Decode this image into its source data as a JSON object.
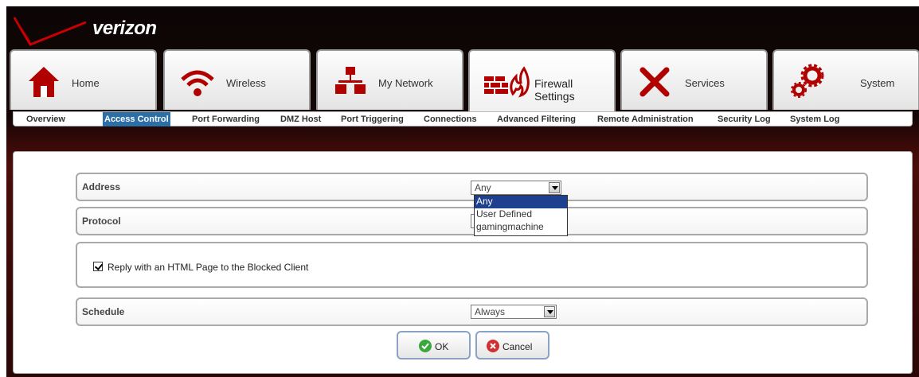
{
  "brand": {
    "logo_text": "verizon",
    "accent": "#cc0000"
  },
  "main_tabs": [
    {
      "label": "Home",
      "icon": "home-icon"
    },
    {
      "label": "Wireless",
      "icon": "wireless-icon"
    },
    {
      "label": "My Network",
      "icon": "network-icon"
    },
    {
      "label": "Firewall Settings",
      "icon": "firewall-icon",
      "active": true
    },
    {
      "label": "Services",
      "icon": "tools-icon"
    },
    {
      "label": "System",
      "icon": "gears-icon"
    }
  ],
  "sub_nav": [
    {
      "label": "Overview"
    },
    {
      "label": "Access Control",
      "active": true
    },
    {
      "label": "Port Forwarding"
    },
    {
      "label": "DMZ Host"
    },
    {
      "label": "Port Triggering"
    },
    {
      "label": "Connections"
    },
    {
      "label": "Advanced Filtering"
    },
    {
      "label": "Remote Administration"
    },
    {
      "label": "Security Log"
    },
    {
      "label": "System Log"
    }
  ],
  "form": {
    "address": {
      "label": "Address",
      "value": "Any"
    },
    "protocol": {
      "label": "Protocol"
    },
    "address_options": [
      "Any",
      "User Defined",
      "gamingmachine"
    ],
    "reply_checkbox": {
      "label": "Reply with an HTML Page to the Blocked Client",
      "checked": true
    },
    "schedule": {
      "label": "Schedule",
      "value": "Always"
    }
  },
  "buttons": {
    "ok": "OK",
    "cancel": "Cancel"
  }
}
